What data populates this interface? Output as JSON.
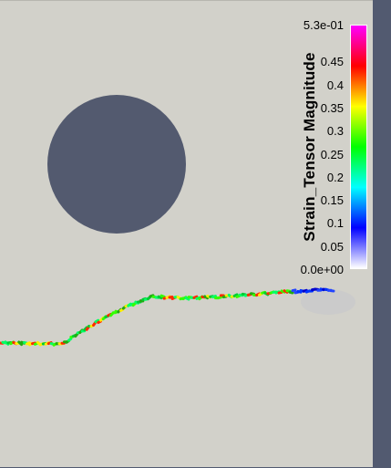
{
  "colorbar": {
    "title": "Strain_Tensor Magnitude",
    "ticks": [
      {
        "label": "5.3e-01",
        "value": 0.53
      },
      {
        "label": "0.45",
        "value": 0.45
      },
      {
        "label": "0.4",
        "value": 0.4
      },
      {
        "label": "0.35",
        "value": 0.35
      },
      {
        "label": "0.3",
        "value": 0.3
      },
      {
        "label": "0.25",
        "value": 0.25
      },
      {
        "label": "0.2",
        "value": 0.2
      },
      {
        "label": "0.15",
        "value": 0.15
      },
      {
        "label": "0.1",
        "value": 0.1
      },
      {
        "label": "0.05",
        "value": 0.05
      },
      {
        "label": "0.0e+00",
        "value": 0.0
      }
    ],
    "range": [
      0.0,
      0.53
    ],
    "colormap": [
      "#ffffff",
      "#0000ff",
      "#00ffff",
      "#00ff00",
      "#ffff00",
      "#ff0000",
      "#ff00ff"
    ]
  },
  "colors": {
    "background": "#525a70",
    "viewport": "#d2d1ca",
    "inclusion": "#535a6f"
  }
}
